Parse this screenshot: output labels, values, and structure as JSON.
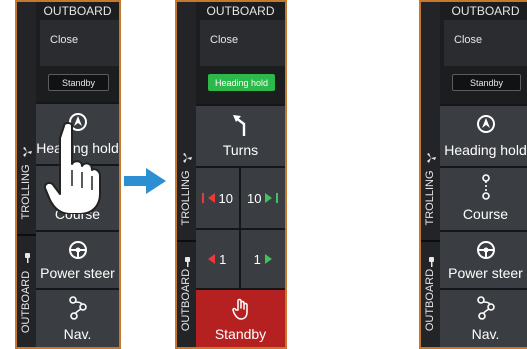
{
  "panels": [
    {
      "header": "OUTBOARD",
      "close": "Close",
      "mode_chip": "Standby",
      "rail": {
        "top_label": "TROLLING",
        "bottom_label": "OUTBOARD"
      },
      "tiles": [
        {
          "label": "Heading hold",
          "icon": "heading-hold-icon"
        },
        {
          "label": "Course",
          "icon": "course-icon"
        },
        {
          "label": "Power steer",
          "icon": "steering-wheel-icon"
        },
        {
          "label": "Nav.",
          "icon": "nav-route-icon"
        }
      ]
    },
    {
      "header": "OUTBOARD",
      "close": "Close",
      "mode_chip": "Heading hold",
      "rail": {
        "top_label": "TROLLING",
        "bottom_label": "OUTBOARD"
      },
      "turns": {
        "label": "Turns",
        "icon": "turn-arrow-icon"
      },
      "adjust_large": {
        "left": "10",
        "right": "10"
      },
      "adjust_small": {
        "left": "1",
        "right": "1"
      },
      "standby": {
        "label": "Standby",
        "icon": "hand-stop-icon"
      }
    },
    {
      "header": "OUTBOARD",
      "close": "Close",
      "mode_chip": "Standby",
      "rail": {
        "top_label": "TROLLING",
        "bottom_label": "OUTBOARD"
      },
      "tiles": [
        {
          "label": "Heading hold",
          "icon": "heading-hold-icon"
        },
        {
          "label": "Course",
          "icon": "course-icon"
        },
        {
          "label": "Power steer",
          "icon": "steering-wheel-icon"
        },
        {
          "label": "Nav.",
          "icon": "nav-route-icon"
        }
      ]
    }
  ],
  "colors": {
    "frame": "#c8782c",
    "active_chip": "#2db84a",
    "standby": "#b52020",
    "arrow": "#2b8fd1",
    "port": "#e83a3a",
    "starboard": "#3fc35a"
  }
}
